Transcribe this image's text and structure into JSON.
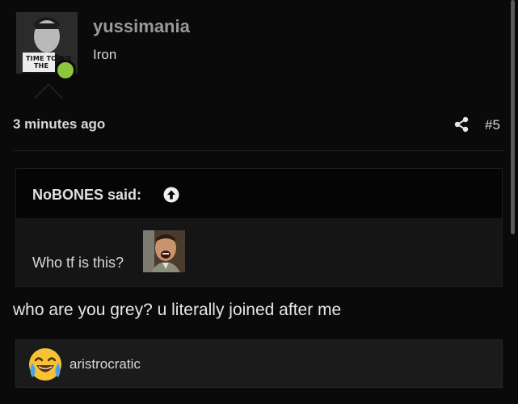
{
  "post": {
    "author": {
      "username": "yussimania",
      "title": "Iron",
      "avatar_caption_line1": "TIME TO DIE",
      "avatar_caption_line2": "THE",
      "online": true,
      "online_color": "#8cc63f"
    },
    "timestamp": "3 minutes ago",
    "share_icon": "share-icon",
    "post_number": "#5"
  },
  "quote": {
    "author_label": "NoBONES said:",
    "jump_icon": "arrow-up-circle-icon",
    "text": "Who tf is this?"
  },
  "message": "who are you grey? u literally joined after me",
  "reactions": {
    "icon": "laughing-crying-emoji-icon",
    "users": "aristrocratic"
  },
  "colors": {
    "background": "#0a0a0a",
    "username": "#9a9a9a",
    "quote_header": "#050505",
    "reaction_bar": "#1b1b1b"
  }
}
